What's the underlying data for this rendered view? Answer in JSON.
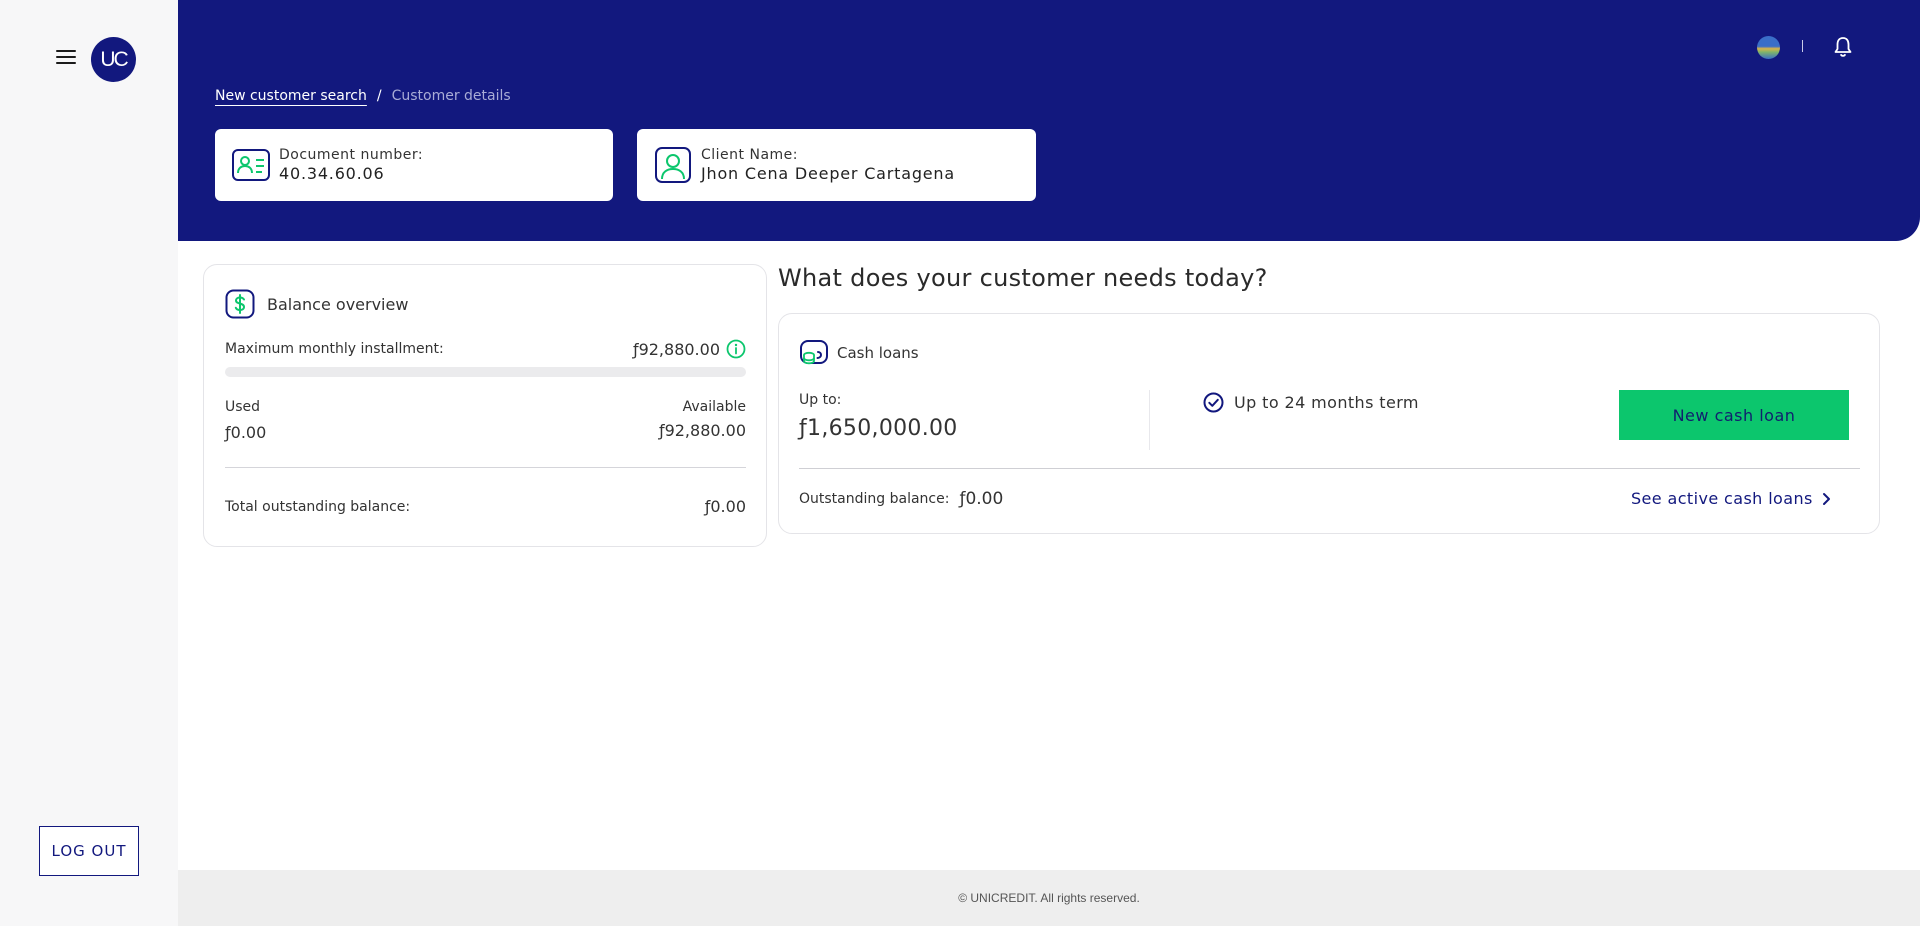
{
  "app": {
    "logo_text": "UC",
    "logout_label": "LOG OUT"
  },
  "header": {
    "breadcrumb": {
      "link": "New customer search",
      "separator": "/",
      "current": "Customer details"
    },
    "document": {
      "label": "Document number:",
      "value": "40.34.60.06"
    },
    "client": {
      "label": "Client Name:",
      "value": "Jhon Cena Deeper Cartagena"
    }
  },
  "balance": {
    "title": "Balance overview",
    "max_label": "Maximum monthly installment:",
    "max_value": "ƒ92,880.00",
    "used_fraction": 0,
    "used_label": "Used",
    "used_value": "ƒ0.00",
    "available_label": "Available",
    "available_value": "ƒ92,880.00",
    "total_label": "Total outstanding balance:",
    "total_value": "ƒ0.00"
  },
  "needs": {
    "question": "What does your customer needs today?",
    "cash_loans": {
      "title": "Cash loans",
      "upto_label": "Up to:",
      "upto_value": "ƒ1,650,000.00",
      "term_text": "Up to 24 months term",
      "new_button": "New cash loan",
      "outstanding_label": "Outstanding balance:",
      "outstanding_value": "ƒ0.00",
      "see_active": "See active cash loans"
    }
  },
  "footer": {
    "text": "© UNICREDIT. All rights reserved."
  },
  "colors": {
    "brand": "#12187e",
    "accent": "#0cc66d",
    "sidebar_bg": "#f7f7f8"
  },
  "icons": [
    "menu-icon",
    "globe-icon",
    "bell-icon",
    "id-card-icon",
    "user-icon",
    "dollar-icon",
    "info-icon",
    "cash-icon",
    "check-circle-icon",
    "chevron-right-icon"
  ]
}
